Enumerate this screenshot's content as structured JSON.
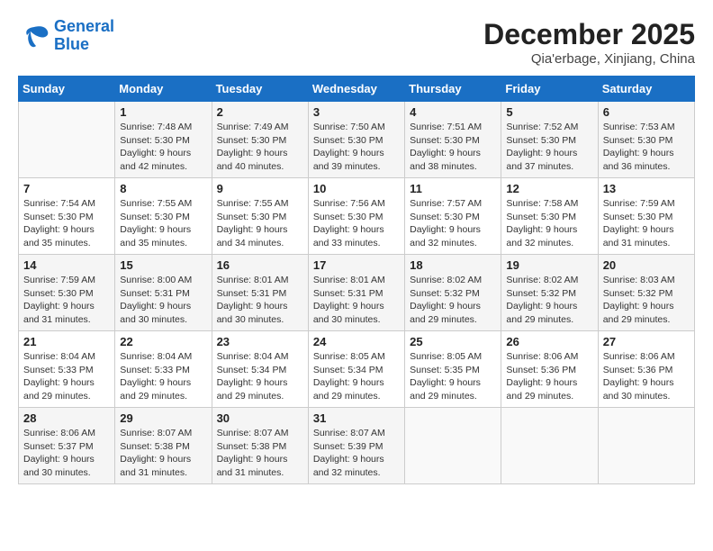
{
  "logo": {
    "text_general": "General",
    "text_blue": "Blue"
  },
  "title": "December 2025",
  "subtitle": "Qia'erbage, Xinjiang, China",
  "days_of_week": [
    "Sunday",
    "Monday",
    "Tuesday",
    "Wednesday",
    "Thursday",
    "Friday",
    "Saturday"
  ],
  "weeks": [
    [
      {
        "day": "",
        "info": ""
      },
      {
        "day": "1",
        "info": "Sunrise: 7:48 AM\nSunset: 5:30 PM\nDaylight: 9 hours\nand 42 minutes."
      },
      {
        "day": "2",
        "info": "Sunrise: 7:49 AM\nSunset: 5:30 PM\nDaylight: 9 hours\nand 40 minutes."
      },
      {
        "day": "3",
        "info": "Sunrise: 7:50 AM\nSunset: 5:30 PM\nDaylight: 9 hours\nand 39 minutes."
      },
      {
        "day": "4",
        "info": "Sunrise: 7:51 AM\nSunset: 5:30 PM\nDaylight: 9 hours\nand 38 minutes."
      },
      {
        "day": "5",
        "info": "Sunrise: 7:52 AM\nSunset: 5:30 PM\nDaylight: 9 hours\nand 37 minutes."
      },
      {
        "day": "6",
        "info": "Sunrise: 7:53 AM\nSunset: 5:30 PM\nDaylight: 9 hours\nand 36 minutes."
      }
    ],
    [
      {
        "day": "7",
        "info": "Sunrise: 7:54 AM\nSunset: 5:30 PM\nDaylight: 9 hours\nand 35 minutes."
      },
      {
        "day": "8",
        "info": "Sunrise: 7:55 AM\nSunset: 5:30 PM\nDaylight: 9 hours\nand 35 minutes."
      },
      {
        "day": "9",
        "info": "Sunrise: 7:55 AM\nSunset: 5:30 PM\nDaylight: 9 hours\nand 34 minutes."
      },
      {
        "day": "10",
        "info": "Sunrise: 7:56 AM\nSunset: 5:30 PM\nDaylight: 9 hours\nand 33 minutes."
      },
      {
        "day": "11",
        "info": "Sunrise: 7:57 AM\nSunset: 5:30 PM\nDaylight: 9 hours\nand 32 minutes."
      },
      {
        "day": "12",
        "info": "Sunrise: 7:58 AM\nSunset: 5:30 PM\nDaylight: 9 hours\nand 32 minutes."
      },
      {
        "day": "13",
        "info": "Sunrise: 7:59 AM\nSunset: 5:30 PM\nDaylight: 9 hours\nand 31 minutes."
      }
    ],
    [
      {
        "day": "14",
        "info": "Sunrise: 7:59 AM\nSunset: 5:30 PM\nDaylight: 9 hours\nand 31 minutes."
      },
      {
        "day": "15",
        "info": "Sunrise: 8:00 AM\nSunset: 5:31 PM\nDaylight: 9 hours\nand 30 minutes."
      },
      {
        "day": "16",
        "info": "Sunrise: 8:01 AM\nSunset: 5:31 PM\nDaylight: 9 hours\nand 30 minutes."
      },
      {
        "day": "17",
        "info": "Sunrise: 8:01 AM\nSunset: 5:31 PM\nDaylight: 9 hours\nand 30 minutes."
      },
      {
        "day": "18",
        "info": "Sunrise: 8:02 AM\nSunset: 5:32 PM\nDaylight: 9 hours\nand 29 minutes."
      },
      {
        "day": "19",
        "info": "Sunrise: 8:02 AM\nSunset: 5:32 PM\nDaylight: 9 hours\nand 29 minutes."
      },
      {
        "day": "20",
        "info": "Sunrise: 8:03 AM\nSunset: 5:32 PM\nDaylight: 9 hours\nand 29 minutes."
      }
    ],
    [
      {
        "day": "21",
        "info": "Sunrise: 8:04 AM\nSunset: 5:33 PM\nDaylight: 9 hours\nand 29 minutes."
      },
      {
        "day": "22",
        "info": "Sunrise: 8:04 AM\nSunset: 5:33 PM\nDaylight: 9 hours\nand 29 minutes."
      },
      {
        "day": "23",
        "info": "Sunrise: 8:04 AM\nSunset: 5:34 PM\nDaylight: 9 hours\nand 29 minutes."
      },
      {
        "day": "24",
        "info": "Sunrise: 8:05 AM\nSunset: 5:34 PM\nDaylight: 9 hours\nand 29 minutes."
      },
      {
        "day": "25",
        "info": "Sunrise: 8:05 AM\nSunset: 5:35 PM\nDaylight: 9 hours\nand 29 minutes."
      },
      {
        "day": "26",
        "info": "Sunrise: 8:06 AM\nSunset: 5:36 PM\nDaylight: 9 hours\nand 29 minutes."
      },
      {
        "day": "27",
        "info": "Sunrise: 8:06 AM\nSunset: 5:36 PM\nDaylight: 9 hours\nand 30 minutes."
      }
    ],
    [
      {
        "day": "28",
        "info": "Sunrise: 8:06 AM\nSunset: 5:37 PM\nDaylight: 9 hours\nand 30 minutes."
      },
      {
        "day": "29",
        "info": "Sunrise: 8:07 AM\nSunset: 5:38 PM\nDaylight: 9 hours\nand 31 minutes."
      },
      {
        "day": "30",
        "info": "Sunrise: 8:07 AM\nSunset: 5:38 PM\nDaylight: 9 hours\nand 31 minutes."
      },
      {
        "day": "31",
        "info": "Sunrise: 8:07 AM\nSunset: 5:39 PM\nDaylight: 9 hours\nand 32 minutes."
      },
      {
        "day": "",
        "info": ""
      },
      {
        "day": "",
        "info": ""
      },
      {
        "day": "",
        "info": ""
      }
    ]
  ]
}
